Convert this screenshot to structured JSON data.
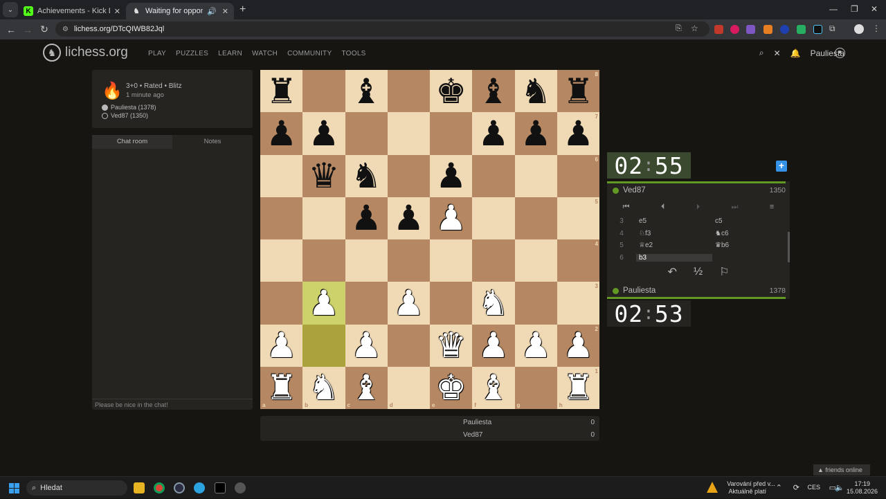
{
  "browser": {
    "tabs": [
      {
        "title": "Achievements - Kick Dashboard",
        "active": false
      },
      {
        "title": "Waiting for opponent - Play",
        "active": true
      }
    ],
    "new_tab": "+",
    "url": "lichess.org/DTcQIWB82Jql"
  },
  "site": {
    "logo": "lichess.org",
    "nav": [
      "PLAY",
      "PUZZLES",
      "LEARN",
      "WATCH",
      "COMMUNITY",
      "TOOLS"
    ],
    "username": "Pauliesta"
  },
  "game": {
    "type": "3+0 • Rated • Blitz",
    "time_ago": "1 minute ago",
    "white_player": "Pauliesta (1378)",
    "black_player": "Ved87 (1350)"
  },
  "chat": {
    "tabs": [
      "Chat room",
      "Notes"
    ],
    "placeholder": "Please be nice in the chat!"
  },
  "board": {
    "ranks": [
      "8",
      "7",
      "6",
      "5",
      "4",
      "3",
      "2",
      "1"
    ],
    "files": [
      "a",
      "b",
      "c",
      "d",
      "e",
      "f",
      "g",
      "h"
    ],
    "position": [
      [
        "bR",
        "",
        "bB",
        "",
        "bK",
        "bB",
        "bN",
        "bR"
      ],
      [
        "bP",
        "bP",
        "",
        "",
        "",
        "bP",
        "bP",
        "bP"
      ],
      [
        "",
        "bQ",
        "bN",
        "",
        "bP",
        "",
        "",
        ""
      ],
      [
        "",
        "",
        "bP",
        "bP",
        "wP",
        "",
        "",
        ""
      ],
      [
        "",
        "",
        "",
        "",
        "",
        "",
        "",
        ""
      ],
      [
        "",
        "wP",
        "",
        "wP",
        "",
        "wN",
        "",
        ""
      ],
      [
        "wP",
        "",
        "wP",
        "",
        "wQ",
        "wP",
        "wP",
        "wP"
      ],
      [
        "wR",
        "wN",
        "wB",
        "",
        "wK",
        "wB",
        "",
        "wR"
      ]
    ],
    "last_move_squares": [
      "b2",
      "b3"
    ]
  },
  "score": [
    {
      "name": "Pauliesta",
      "score": "0"
    },
    {
      "name": "Ved87",
      "score": "0"
    }
  ],
  "clocks": {
    "top": {
      "min": "02",
      "sec": "55"
    },
    "bottom": {
      "min": "02",
      "sec": "53"
    }
  },
  "players": {
    "top": {
      "name": "Ved87",
      "rating": "1350"
    },
    "bottom": {
      "name": "Pauliesta",
      "rating": "1378"
    }
  },
  "moves": [
    {
      "n": "3",
      "w": "e5",
      "b": "c5"
    },
    {
      "n": "4",
      "w": "♘f3",
      "b": "♞c6"
    },
    {
      "n": "5",
      "w": "♕e2",
      "b": "♛b6"
    },
    {
      "n": "6",
      "w": "b3",
      "b": ""
    }
  ],
  "current_move": "b3",
  "friends": "▲ friends online",
  "taskbar": {
    "search": "Hledat",
    "notice1": "Varování před v...",
    "notice2": "Aktuálně platí",
    "lang": "CES",
    "time": "17:19",
    "date": "15.08.2026"
  },
  "colors": {
    "light_square": "#f0d9b5",
    "dark_square": "#b58863",
    "highlight": "#aaa23a",
    "green": "#629924",
    "bg": "#161512"
  }
}
